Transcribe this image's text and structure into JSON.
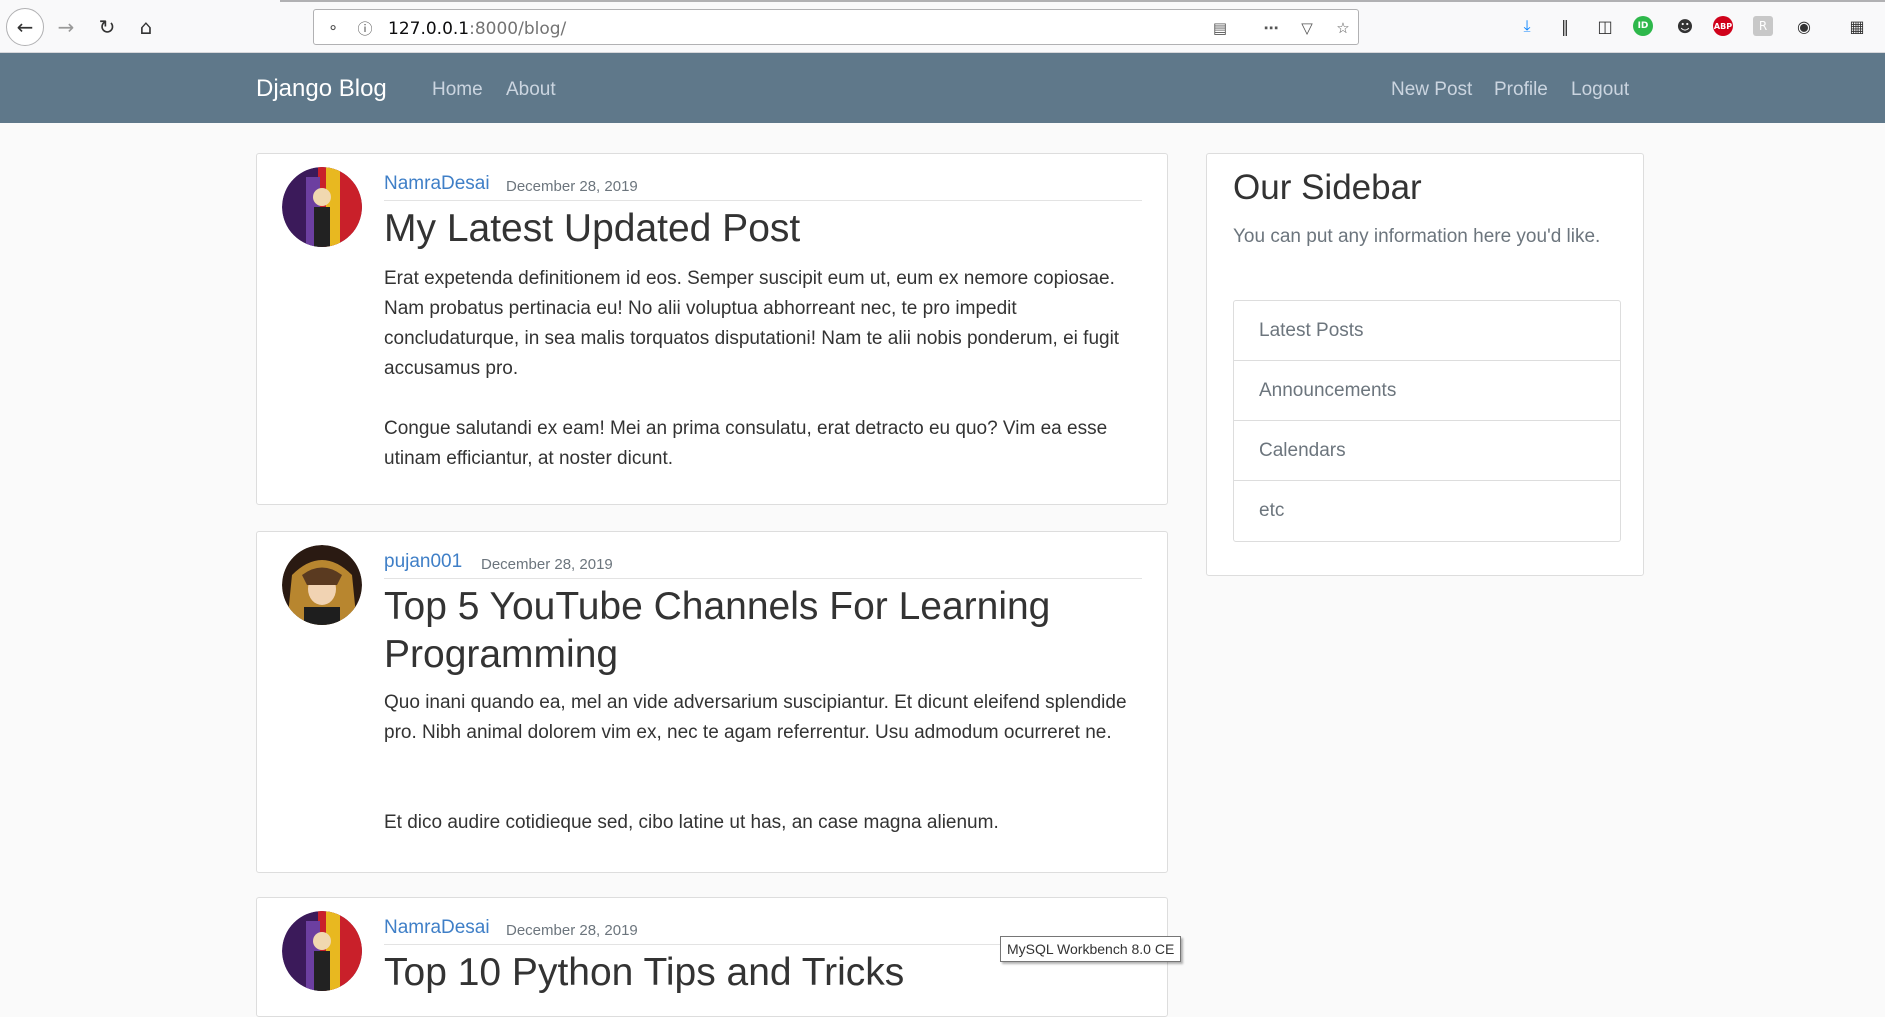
{
  "browser": {
    "url_host": "127.0.0.1",
    "url_rest": ":8000/blog/",
    "icons": [
      "back-icon",
      "forward-icon",
      "reload-icon",
      "home-icon",
      "shield-icon",
      "info-icon",
      "reader-icon",
      "more-icon",
      "pocket-icon",
      "star-icon",
      "download-icon",
      "library-icon",
      "sidebar-icon",
      "extension-icon",
      "account-icon",
      "adblock-icon",
      "extension-icon",
      "sync-icon",
      "grid-icon"
    ]
  },
  "navbar": {
    "brand": "Django Blog",
    "left_links": [
      "Home",
      "About"
    ],
    "right_links": [
      "New Post",
      "Profile",
      "Logout"
    ],
    "bg_color": "#5f788a"
  },
  "posts": [
    {
      "author": "NamraDesai",
      "date": "December 28, 2019",
      "title": "My Latest Updated Post",
      "paragraphs": [
        "Erat expetenda definitionem id eos. Semper suscipit eum ut, eum ex nemore copiosae. Nam probatus pertinacia eu! No alii voluptua abhorreant nec, te pro impedit concludaturque, in sea malis torquatos disputationi! Nam te alii nobis ponderum, ei fugit accusamus pro.",
        "Congue salutandi ex eam! Mei an prima consulatu, erat detracto eu quo? Vim ea esse utinam efficiantur, at noster dicunt."
      ]
    },
    {
      "author": "pujan001",
      "date": "December 28, 2019",
      "title_lines": [
        "Top 5 YouTube Channels For Learning",
        "Programming"
      ],
      "paragraphs": [
        "Quo inani quando ea, mel an vide adversarium suscipiantur. Et dicunt eleifend splendide pro. Nibh animal dolorem vim ex, nec te agam referrentur. Usu admodum ocurreret ne.",
        "Et dico audire cotidieque sed, cibo latine ut has, an case magna alienum."
      ]
    },
    {
      "author": "NamraDesai",
      "date": "December 28, 2019",
      "title": "Top 10 Python Tips and Tricks"
    }
  ],
  "sidebar": {
    "title": "Our Sidebar",
    "lead": "You can put any information here you'd like.",
    "items": [
      "Latest Posts",
      "Announcements",
      "Calendars",
      "etc"
    ]
  },
  "tooltip": "MySQL Workbench 8.0 CE",
  "colors": {
    "link": "#3f7fc7",
    "muted": "#6c757d"
  }
}
